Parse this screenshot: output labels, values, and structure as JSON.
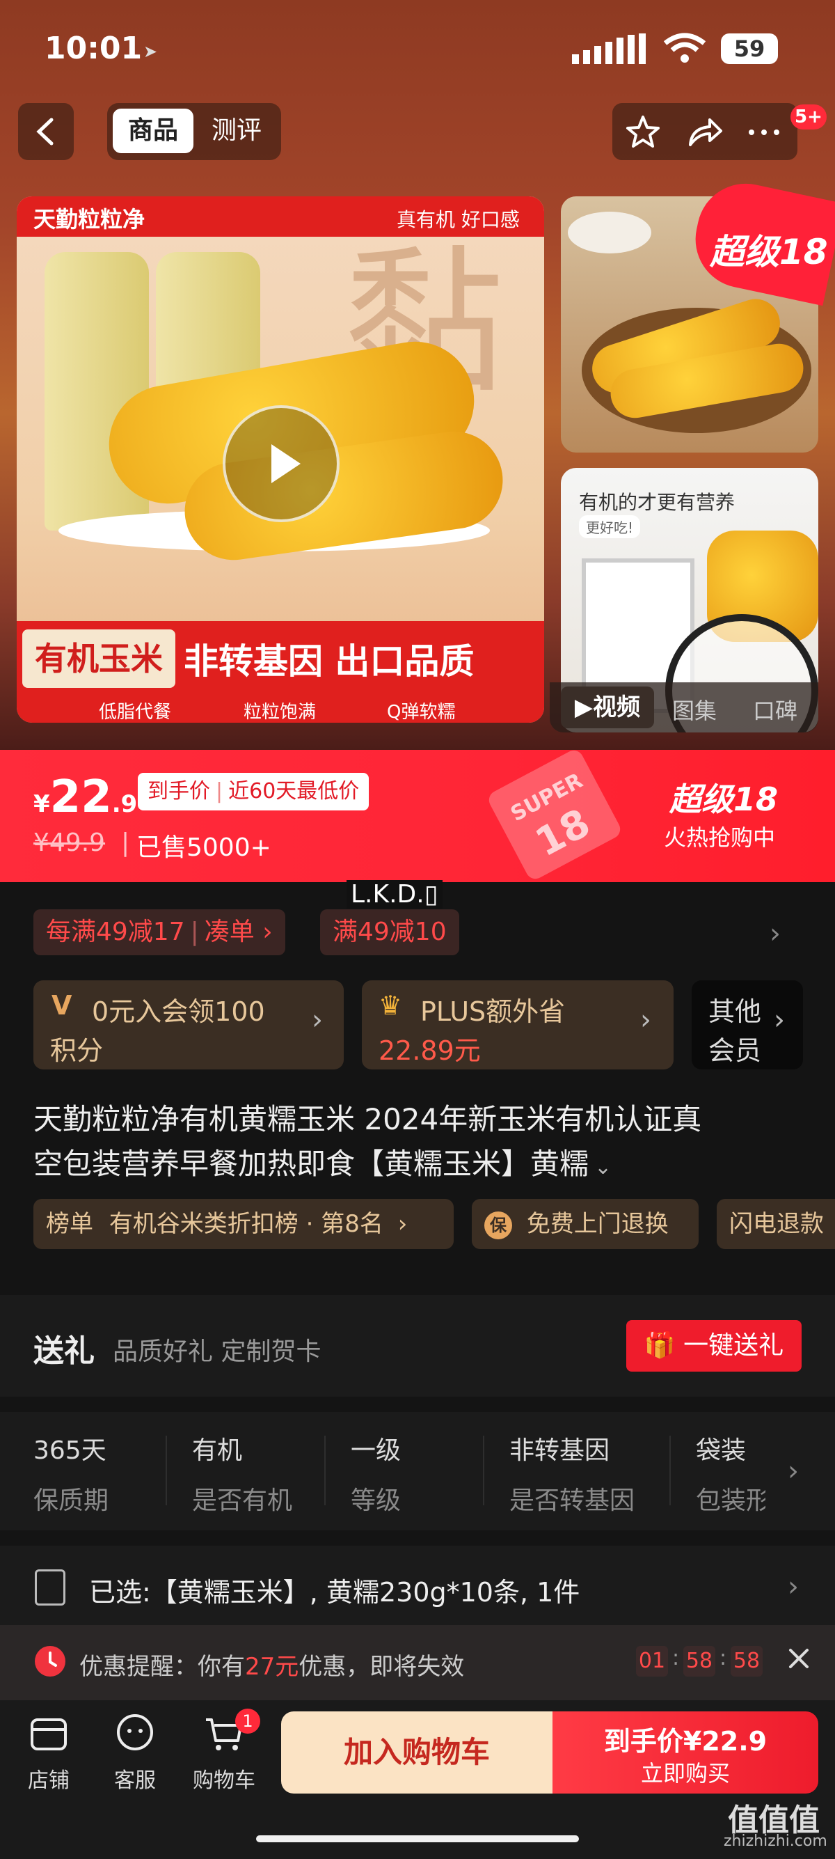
{
  "status": {
    "time": "10:01",
    "battery": "59"
  },
  "nav": {
    "tab_product": "商品",
    "tab_review": "测评",
    "badge": "5+"
  },
  "gallery": {
    "banner_brand": "天勤粒粒净",
    "banner_tags": "真有机 好口感",
    "big_char": "黏",
    "main_tag": "有机玉米",
    "main_slogan": "非转基因 出口品质",
    "sub_tags": [
      "低脂代餐",
      "粒粒饱满",
      "Q弹软糯"
    ],
    "promo_badge": "超级18",
    "thumb2_title": "有机的才更有营养",
    "thumb2_sub": "更好吃!",
    "media_tabs": [
      "视频",
      "图集",
      "口碑"
    ]
  },
  "price": {
    "currency": "¥",
    "int": "22",
    "dec": ".9",
    "tag_a": "到手价",
    "tag_b": "近60天最低价",
    "original": "¥49.9",
    "sold": "已售5000+",
    "stamp_top": "SUPER",
    "stamp_num": "18",
    "event_title": "超级18",
    "event_sub": "火热抢购中"
  },
  "watermark_text": "L.K.D.▯",
  "coupons": {
    "c1": "每满49减17",
    "c1_action": "凑单",
    "c2": "满49减10"
  },
  "member": {
    "m1_line1": "0元入会领100",
    "m1_line2": "积分",
    "m2_line1": "PLUS额外省",
    "m2_line2": "22.89元",
    "m3_line1": "其他",
    "m3_line2": "会员"
  },
  "title": {
    "line1": "天勤粒粒净有机黄糯玉米 2024年新玉米有机认证真",
    "line2": "空包装营养早餐加热即食【黄糯玉米】黄糯"
  },
  "badges": {
    "rank_label": "榜单",
    "rank_text": "有机谷米类折扣榜 · 第8名",
    "service1": "免费上门退换",
    "service2": "闪电退款"
  },
  "gift": {
    "title": "送礼",
    "sub": "品质好礼 定制贺卡",
    "button": "一键送礼"
  },
  "specs": [
    {
      "value": "365天",
      "key": "保质期"
    },
    {
      "value": "有机",
      "key": "是否有机"
    },
    {
      "value": "一级",
      "key": "等级"
    },
    {
      "value": "非转基因",
      "key": "是否转基因"
    },
    {
      "value": "袋装",
      "key": "包装形"
    }
  ],
  "selected": {
    "text": "已选:【黄糯玉米】, 黄糯230g*10条, 1件"
  },
  "reminder": {
    "prefix": "优惠提醒：你有",
    "amount": "27元",
    "suffix": "优惠，即将失效",
    "h": "01",
    "m": "58",
    "s": "58"
  },
  "tabbar": {
    "shop": "店铺",
    "service": "客服",
    "cart": "购物车",
    "cart_badge": "1",
    "add_cart": "加入购物车",
    "buy_price": "到手价¥22.9",
    "buy_now": "立即购买"
  },
  "footer_watermark": {
    "main": "值值值",
    "url": "zhizhizhi.com"
  }
}
